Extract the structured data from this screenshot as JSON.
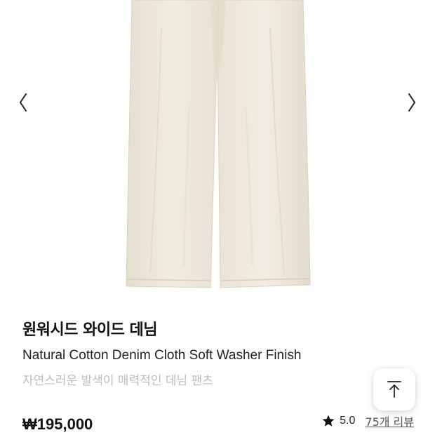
{
  "product": {
    "title_ko": "원워시드 와이드 데님",
    "title_en": "Natural Cotton Denim Cloth Soft Washer Finish",
    "description": "자연스러운 발색이 매력적인 데님 팬츠",
    "price": "₩195,000",
    "image_color": "#efe9dc"
  },
  "rating": {
    "score": "5.0",
    "reviews_label": "75개 리뷰",
    "icon": "star-icon"
  },
  "gallery": {
    "prev_icon": "chevron-left-icon",
    "next_icon": "chevron-right-icon"
  },
  "scroll_top": {
    "icon": "arrow-up-to-top-icon"
  }
}
